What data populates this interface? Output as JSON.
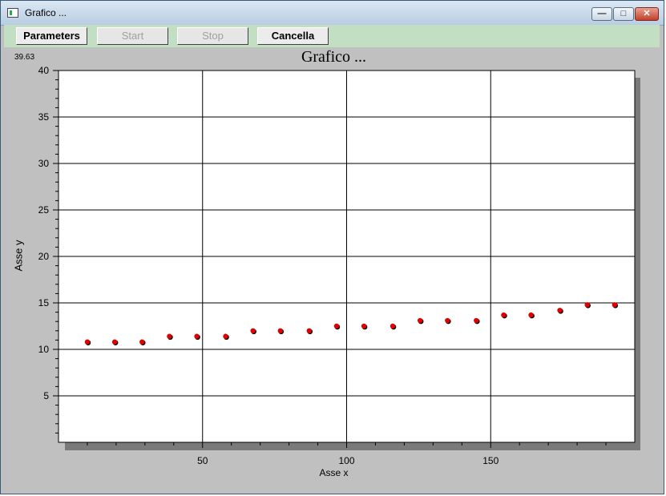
{
  "window": {
    "title": "Grafico ..."
  },
  "toolbar": {
    "parameters": "Parameters",
    "start": "Start",
    "stop": "Stop",
    "cancella": "Cancella"
  },
  "readout": "39.63",
  "chart_data": {
    "type": "scatter",
    "title": "Grafico ...",
    "xlabel": "Asse x",
    "ylabel": "Asse y",
    "xlim": [
      0,
      200
    ],
    "ylim": [
      0,
      40
    ],
    "xticks": [
      50,
      100,
      150
    ],
    "yticks": [
      5,
      10,
      15,
      20,
      25,
      30,
      35,
      40
    ],
    "grid": true,
    "point_color": "#e00000",
    "x": [
      10,
      19.5,
      29,
      38.5,
      48,
      58,
      67.5,
      77,
      87,
      96.5,
      106,
      116,
      125.5,
      135,
      145,
      154.5,
      164,
      174,
      183.5,
      193
    ],
    "y": [
      10.8,
      10.8,
      10.8,
      11.4,
      11.4,
      11.4,
      12.0,
      12.0,
      12.0,
      12.5,
      12.5,
      12.5,
      13.1,
      13.1,
      13.1,
      13.7,
      13.7,
      14.2,
      14.8,
      14.8
    ]
  }
}
